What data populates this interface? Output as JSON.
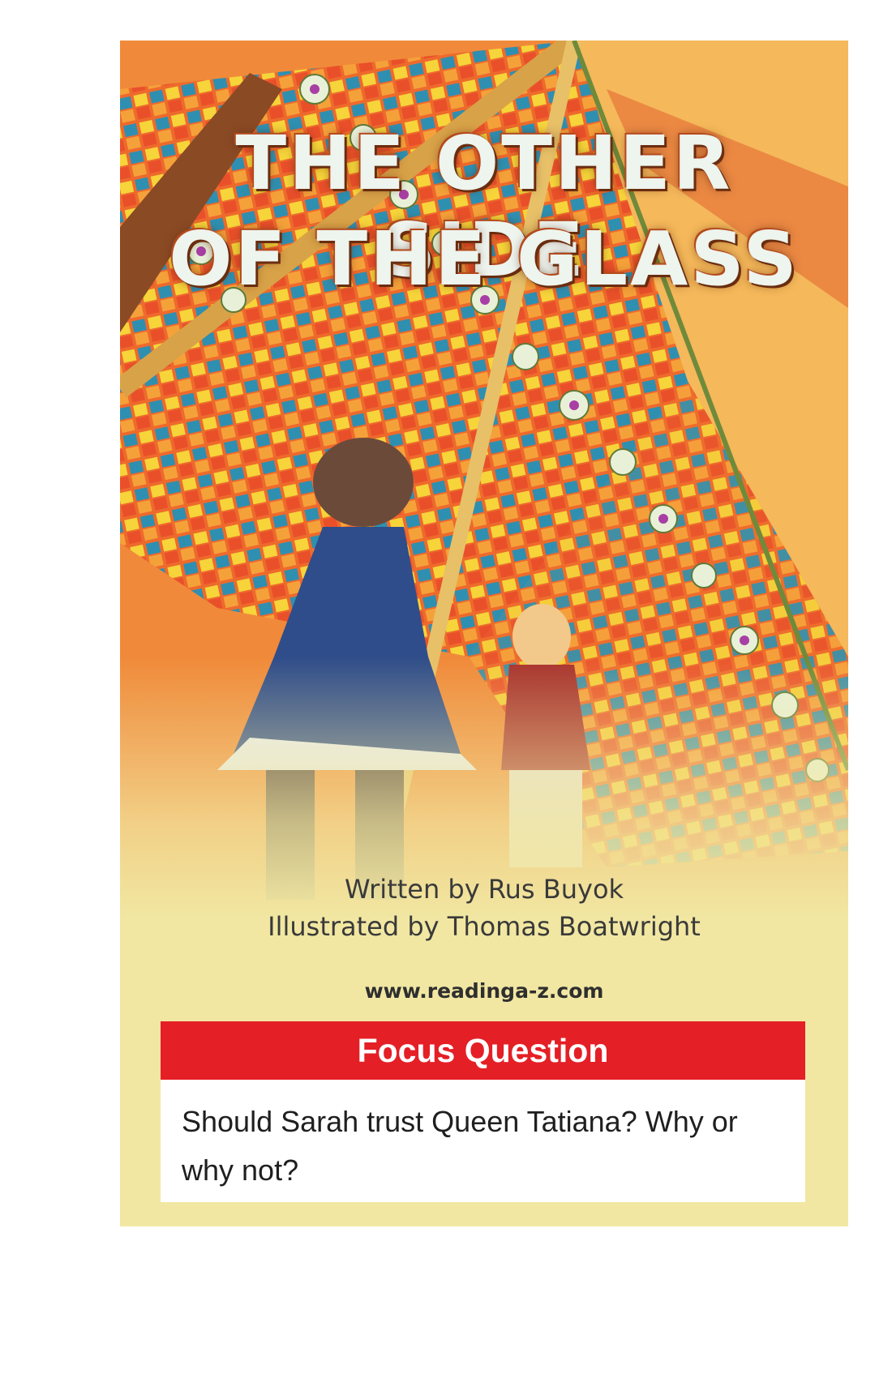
{
  "title": {
    "line1": "THE OTHER SIDE",
    "line2": "OF THE GLASS"
  },
  "credits": {
    "written": "Written by Rus Buyok",
    "illustrated": "Illustrated by Thomas Boatwright"
  },
  "website": "www.readinga-z.com",
  "focus": {
    "header": "Focus Question",
    "question": "Should Sarah trust Queen Tatiana? Why or why not?"
  },
  "colors": {
    "focus_red": "#e41f26",
    "cover_yellow": "#f1e7a2",
    "cover_orange": "#f08a3a"
  }
}
